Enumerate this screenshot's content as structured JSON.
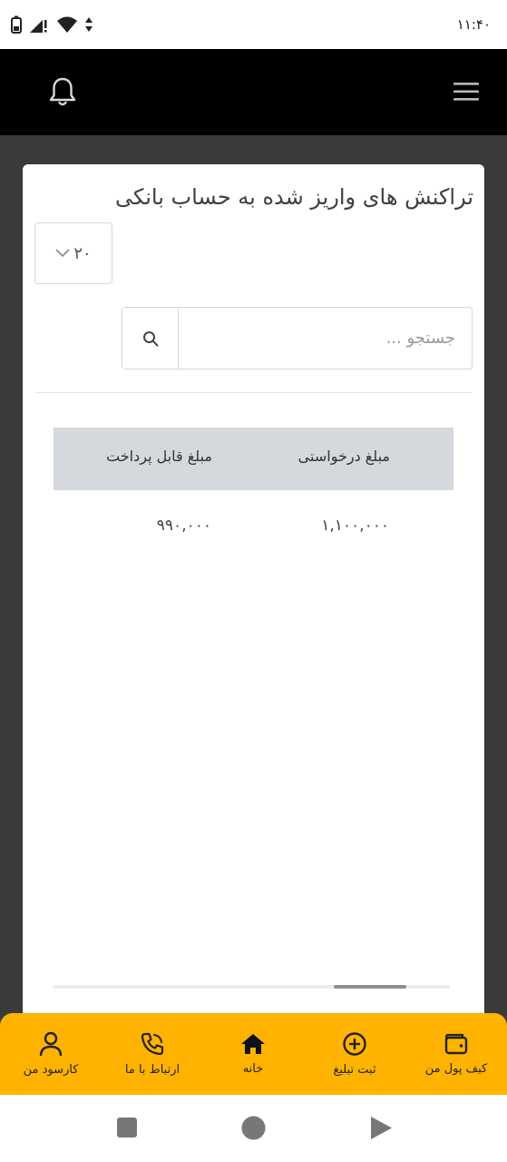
{
  "status_bar": {
    "time": "۱۱:۴۰",
    "icons": [
      "battery-icon",
      "signal-alert-icon",
      "wifi-icon",
      "data-arrows-icon"
    ]
  },
  "app_bar": {
    "icons": [
      "bell-icon",
      "hamburger-menu-icon"
    ]
  },
  "card": {
    "title": "تراکنش های واریز شده به حساب بانکی",
    "page_size": "۲۰",
    "search": {
      "placeholder": "جستجو ...",
      "value": ""
    },
    "table": {
      "headers": [
        "مبلغ درخواستی",
        "مبلغ قابل پرداخت"
      ],
      "rows": [
        [
          "۱,۱۰۰,۰۰۰",
          "۹۹۰,۰۰۰"
        ]
      ]
    }
  },
  "bottom_nav": {
    "items": [
      {
        "label": "کیف پول من",
        "icon": "wallet-icon"
      },
      {
        "label": "ثبت تبلیغ",
        "icon": "plus-circle-icon"
      },
      {
        "label": "خانه",
        "icon": "home-icon"
      },
      {
        "label": "ارتباط با ما",
        "icon": "phone-icon"
      },
      {
        "label": "کارسود من",
        "icon": "user-icon"
      }
    ]
  },
  "system_nav": {
    "icons": [
      "recents-square-icon",
      "home-circle-icon",
      "back-triangle-icon"
    ]
  },
  "colors": {
    "accent": "#ffb300",
    "app_bar": "#000000",
    "background": "#3a3a3a",
    "table_header": "#d5d8dc"
  }
}
